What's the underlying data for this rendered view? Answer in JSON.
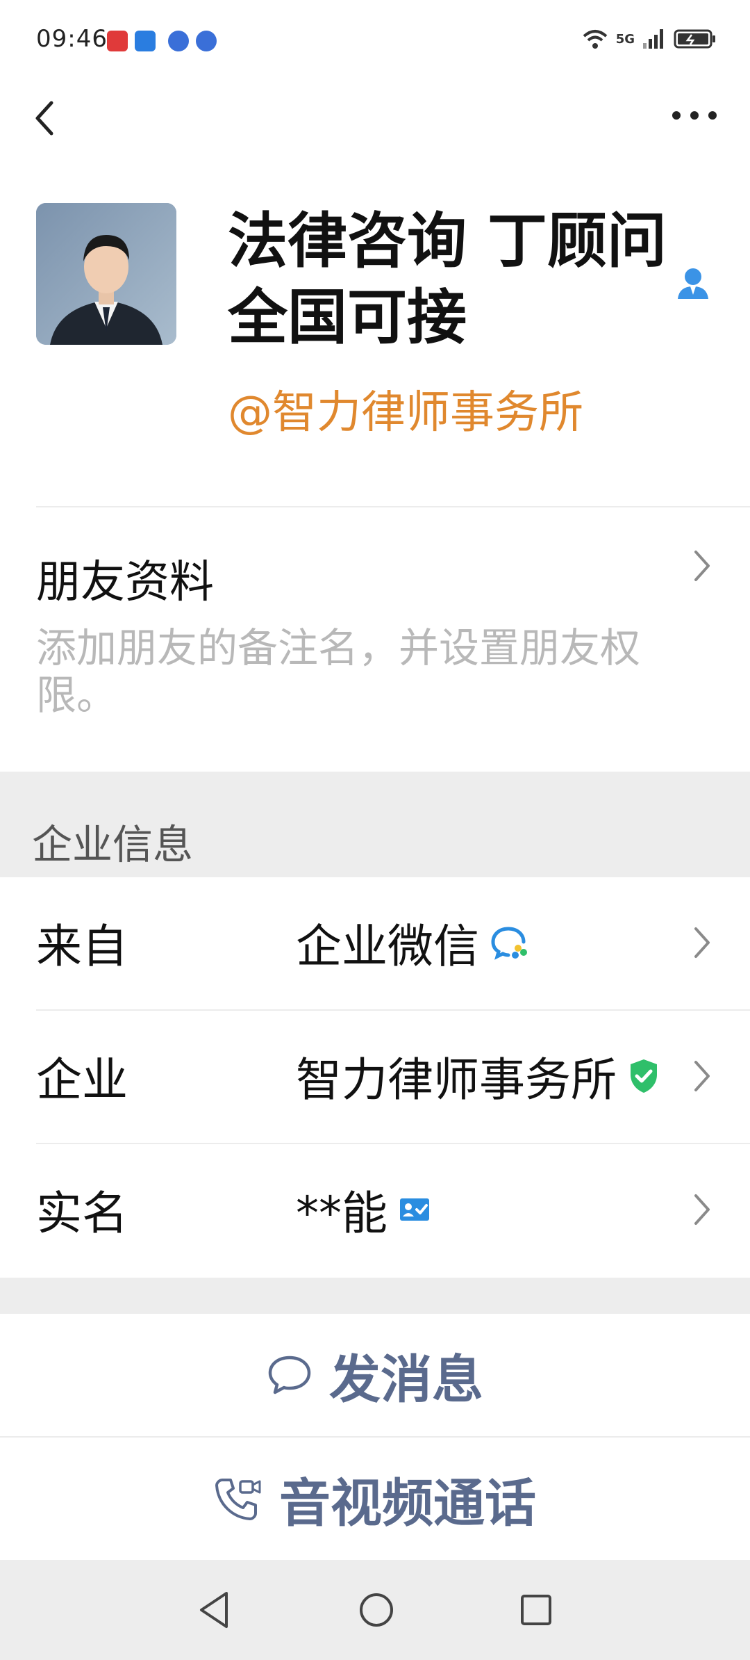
{
  "status_bar": {
    "time": "09:46",
    "network": "5G",
    "notification_icons": [
      "app-icon-red",
      "app-icon-fish-live",
      "app-icon-blue",
      "app-icon-blue"
    ]
  },
  "nav": {
    "back_icon": "chevron-left-icon",
    "more_icon": "ellipsis-icon"
  },
  "profile": {
    "name": "法律咨询 丁顾问 全国可接",
    "company_tag": "@智力律师事务所",
    "contact_icon": "person-icon",
    "accent_color": "#e0882e"
  },
  "friend_profile": {
    "title": "朋友资料",
    "description": "添加朋友的备注名，并设置朋友权限。"
  },
  "enterprise": {
    "section_title": "企业信息",
    "rows": [
      {
        "label": "来自",
        "value": "企业微信"
      },
      {
        "label": "企业",
        "value": "智力律师事务所"
      },
      {
        "label": "实名",
        "value": "**能"
      }
    ]
  },
  "actions": {
    "message": "发消息",
    "call": "音视频通话",
    "color": "#5a6a8d"
  },
  "colors": {
    "verified_green": "#2fbf6a",
    "id_blue": "#2a8de0",
    "section_bg": "#ededed"
  }
}
